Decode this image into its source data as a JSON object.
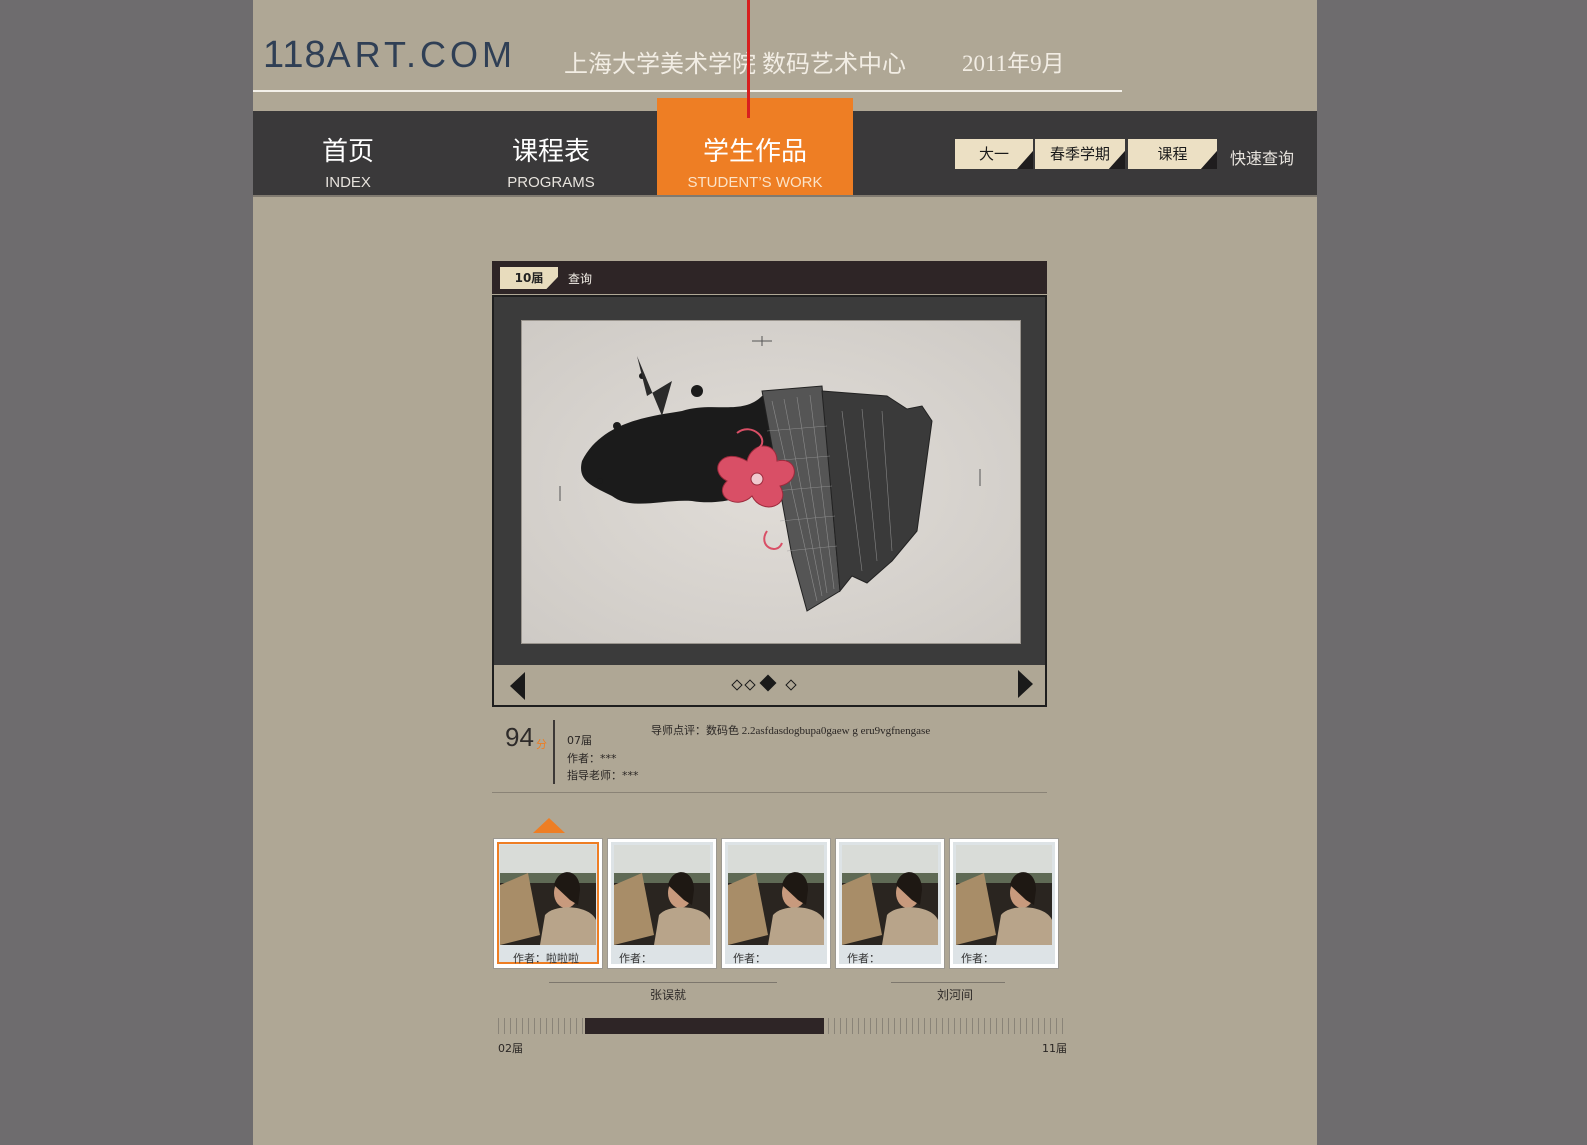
{
  "header": {
    "logo_main": "118",
    "logo_rest": "ART.COM",
    "title": "上海大学美术学院  数码艺术中心",
    "date": "2011年9月"
  },
  "nav": [
    {
      "label": "首页",
      "sub": "INDEX"
    },
    {
      "label": "课程表",
      "sub": "PROGRAMS"
    },
    {
      "label": "学生作品",
      "sub": "STUDENT’S WORK"
    }
  ],
  "quick_search": {
    "year": "大一",
    "term": "春季学期",
    "course": "课程",
    "label": "快速查询"
  },
  "viewer": {
    "edition_tag": "10届",
    "search_label": "查询",
    "dots": 4,
    "active_dot": 3
  },
  "work": {
    "score": "94",
    "score_unit": "分",
    "edition": "07届",
    "author": "作者：***",
    "advisor": "指导老师：***",
    "review_label": "导师点评：",
    "review_text": "数码色 2.2asfdasdogbupa0gaew g eru9vgfnengase"
  },
  "thumbnails": [
    {
      "caption": "作者：啦啦啦",
      "selected": true
    },
    {
      "caption": "作者：",
      "selected": false
    },
    {
      "caption": "作者：",
      "selected": false
    },
    {
      "caption": "作者：",
      "selected": false
    },
    {
      "caption": "作者：",
      "selected": false
    }
  ],
  "groups": [
    "张误就",
    "刘河间"
  ],
  "timeline": {
    "start": "02届",
    "end": "11届"
  },
  "colors": {
    "accent": "#ee7e24",
    "nav_bg": "#3a393a",
    "page_bg": "#afa795",
    "outer_bg": "#6e6c6e"
  }
}
